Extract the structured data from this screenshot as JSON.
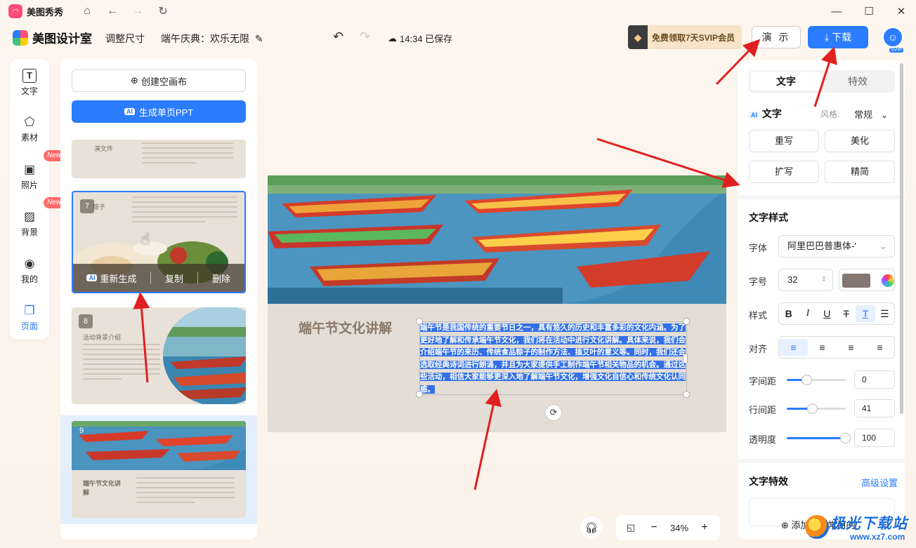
{
  "app": {
    "name": "美图秀秀",
    "logo_icon": "meitu-logo-icon"
  },
  "window": {
    "home_icon": "home-icon",
    "back_icon": "arrow-left-icon",
    "forward_icon": "arrow-right-icon",
    "refresh_icon": "refresh-icon"
  },
  "toolbar": {
    "brand": "美图设计室",
    "resize": "调整尺寸",
    "doc_title": "端午庆典：欢乐无限",
    "save_status": "14:34 已保存",
    "svip": "免费领取7天SVIP会员",
    "demo": "演 示",
    "download": "下载",
    "avatar_badge": "SVIP"
  },
  "rail": {
    "items": [
      {
        "label": "文字",
        "icon": "text-icon"
      },
      {
        "label": "素材",
        "icon": "shapes-icon"
      },
      {
        "label": "照片",
        "icon": "image-icon",
        "badge": "New"
      },
      {
        "label": "背景",
        "icon": "background-icon",
        "badge": "New"
      },
      {
        "label": "我的",
        "icon": "user-icon"
      },
      {
        "label": "页面",
        "icon": "page-add-icon",
        "active": true
      }
    ]
  },
  "pages": {
    "create": "创建空画布",
    "ai_tag": "AI",
    "generate": "生成单页PPT",
    "thumbs": [
      {
        "num": "",
        "title": "演文件"
      },
      {
        "num": "7",
        "title": "粽子",
        "actions": {
          "ai": "AI",
          "regenerate": "重新生成",
          "copy": "复制",
          "delete": "删除"
        }
      },
      {
        "num": "8",
        "title": "活动背景介绍"
      },
      {
        "num": "9",
        "title": "端午节文化讲解"
      }
    ]
  },
  "canvas": {
    "title": "端午节文化讲解",
    "body": "端午节是我国传统的重要节日之一，具有悠久的历史和丰富多彩的文化内涵。为了更好地了解和传承端午节文化，我们将在活动中进行文化讲解。具体来说，我们会介绍端午节的来历、传统食品粽子的制作方法、插艾叶的意义等。同时，我们还会选取经典诗词进行朗诵，并且为大家提供手工制作端午节相关物品的机会。通过这些活动，相信大家能够更深入地了解端午节文化，增强文化自信心和传统文化认同感。"
  },
  "zoom": {
    "level": "34%",
    "minus": "−",
    "plus": "+"
  },
  "props": {
    "tab_text": "文字",
    "tab_effect": "特效",
    "ai_tag": "AI",
    "ai_text": "文字",
    "style_label": "风格:",
    "style_value": "常规",
    "rewrite": "重写",
    "beautify": "美化",
    "expand": "扩写",
    "simplify": "精简",
    "text_style_head": "文字样式",
    "font_label": "字体",
    "font_value": "阿里巴巴普惠体-'",
    "size_label": "字号",
    "size_value": "32",
    "style_row_label": "样式",
    "align_label": "对齐",
    "letter_label": "字间距",
    "letter_value": "0",
    "line_label": "行间距",
    "line_value": "41",
    "opacity_label": "透明度",
    "opacity_value": "100",
    "effect_head": "文字特效",
    "advanced": "高级设置",
    "text_color": "#857770"
  },
  "add_common": "添加至我常用的",
  "watermark": {
    "name": "极光下载站",
    "url": "www.xz7.com"
  },
  "colors": {
    "accent": "#2b7cff",
    "annotation": "#e02020"
  }
}
